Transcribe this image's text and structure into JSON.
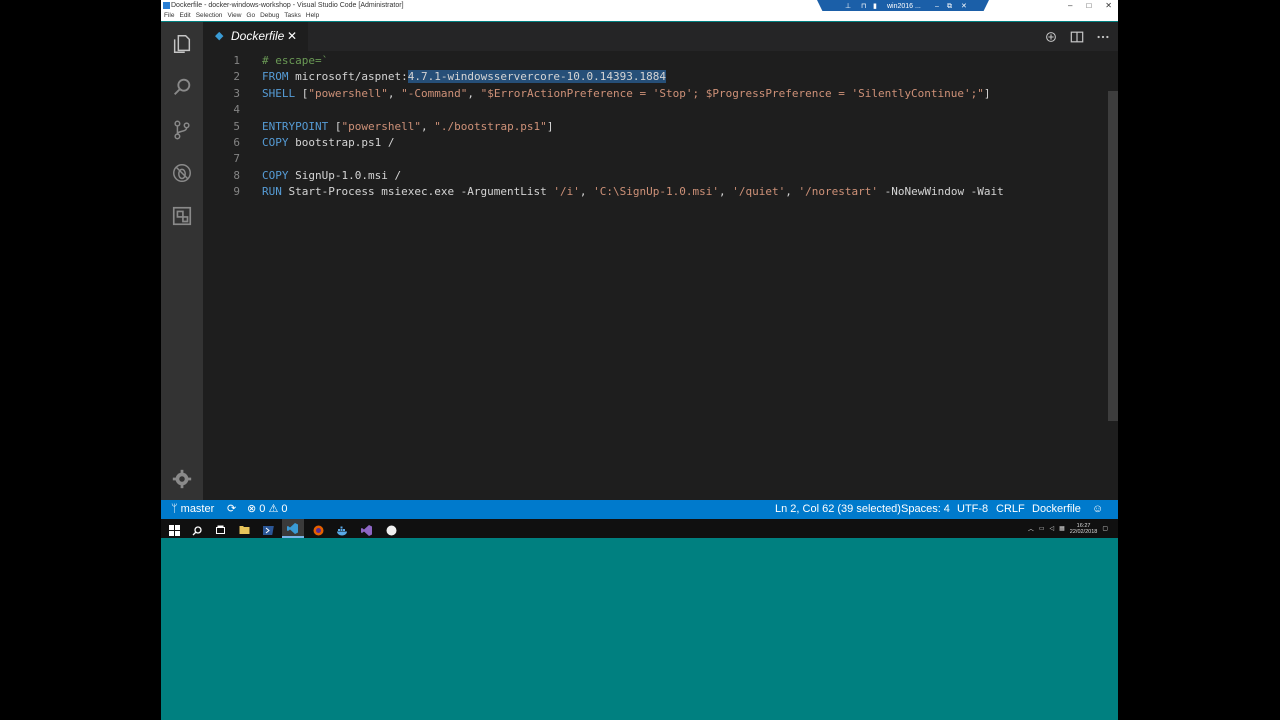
{
  "window": {
    "title": "Dockerfile - docker-windows-workshop - Visual Studio Code [Administrator]",
    "controls": [
      "–",
      "□",
      "✕"
    ]
  },
  "menu": [
    "File",
    "Edit",
    "Selection",
    "View",
    "Go",
    "Debug",
    "Tasks",
    "Help"
  ],
  "rdp": {
    "host": "win2016 ..."
  },
  "activity_bar": {
    "icons": [
      "files-icon",
      "search-icon",
      "source-control-icon",
      "debug-icon",
      "extensions-icon"
    ],
    "manage": "gear-icon"
  },
  "tab": {
    "label": "Dockerfile",
    "close": "✕"
  },
  "editor": {
    "lines": [
      {
        "n": "1",
        "parts": [
          {
            "t": "# escape=`",
            "c": "cmt"
          }
        ]
      },
      {
        "n": "2",
        "parts": [
          {
            "t": "FROM",
            "c": "kw"
          },
          {
            "t": " microsoft/aspnet:",
            "c": ""
          },
          {
            "t": "4.7.1-windowsservercore-10.0.14393.1884",
            "c": "sel"
          }
        ]
      },
      {
        "n": "3",
        "parts": [
          {
            "t": "SHELL",
            "c": "kw"
          },
          {
            "t": " [",
            "c": ""
          },
          {
            "t": "\"powershell\"",
            "c": "str"
          },
          {
            "t": ", ",
            "c": ""
          },
          {
            "t": "\"-Command\"",
            "c": "str"
          },
          {
            "t": ", ",
            "c": ""
          },
          {
            "t": "\"$ErrorActionPreference = 'Stop'; $ProgressPreference = 'SilentlyContinue';\"",
            "c": "str"
          },
          {
            "t": "]",
            "c": ""
          }
        ]
      },
      {
        "n": "4",
        "parts": []
      },
      {
        "n": "5",
        "parts": [
          {
            "t": "ENTRYPOINT",
            "c": "kw"
          },
          {
            "t": " [",
            "c": ""
          },
          {
            "t": "\"powershell\"",
            "c": "str"
          },
          {
            "t": ", ",
            "c": ""
          },
          {
            "t": "\"./bootstrap.ps1\"",
            "c": "str"
          },
          {
            "t": "]",
            "c": ""
          }
        ]
      },
      {
        "n": "6",
        "parts": [
          {
            "t": "COPY",
            "c": "kw"
          },
          {
            "t": " bootstrap.ps1 /",
            "c": ""
          }
        ]
      },
      {
        "n": "7",
        "parts": []
      },
      {
        "n": "8",
        "parts": [
          {
            "t": "COPY",
            "c": "kw"
          },
          {
            "t": " SignUp-1.0.msi /",
            "c": ""
          }
        ]
      },
      {
        "n": "9",
        "parts": [
          {
            "t": "RUN",
            "c": "kw"
          },
          {
            "t": " Start-Process msiexec.exe -ArgumentList ",
            "c": ""
          },
          {
            "t": "'/i'",
            "c": "str"
          },
          {
            "t": ", ",
            "c": ""
          },
          {
            "t": "'C:\\SignUp-1.0.msi'",
            "c": "str"
          },
          {
            "t": ", ",
            "c": ""
          },
          {
            "t": "'/quiet'",
            "c": "str"
          },
          {
            "t": ", ",
            "c": ""
          },
          {
            "t": "'/norestart'",
            "c": "str"
          },
          {
            "t": " -NoNewWindow -Wait",
            "c": ""
          }
        ]
      }
    ]
  },
  "status": {
    "branch": "master",
    "errors": "0",
    "warnings": "0",
    "position": "Ln 2, Col 62 (39 selected)",
    "spaces": "Spaces: 4",
    "encoding": "UTF-8",
    "eol": "CRLF",
    "language": "Dockerfile"
  },
  "taskbar": {
    "time": "16:27",
    "date": "22/02/2018"
  },
  "colors": {
    "accent": "#007acc",
    "editor_bg": "#1e1e1e",
    "keyword": "#569cd6",
    "string": "#ce9178",
    "selection": "#264f78",
    "desktop": "#008080"
  }
}
